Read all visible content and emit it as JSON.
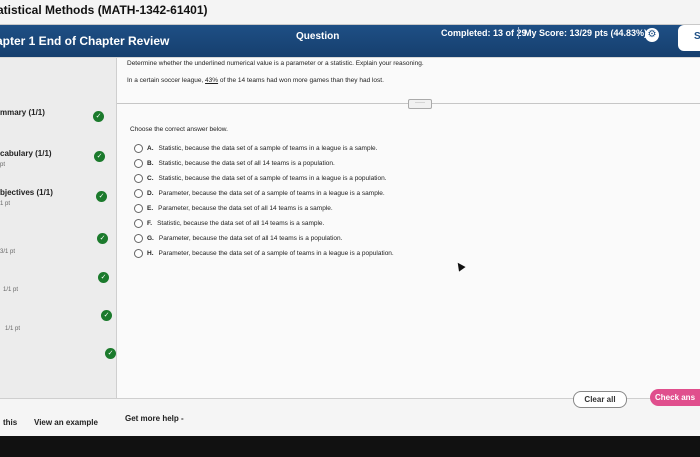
{
  "course_title": "atistical Methods (MATH-1342-61401)",
  "header": {
    "chapter": "apter 1 End of Chapter Review",
    "question_label": "Question",
    "completed": "Completed: 13 of 29",
    "score": "My Score: 13/29 pts (44.83%)",
    "save_label": "S"
  },
  "sidebar": {
    "items": [
      {
        "title": "mmary (1/1)",
        "sub": ""
      },
      {
        "title": "cabulary (1/1)",
        "sub": "pt"
      },
      {
        "title": "bjectives (1/1)",
        "sub": "1 pt"
      },
      {
        "title": "",
        "sub": "3/1 pt"
      },
      {
        "title": "",
        "sub": "1/1 pt"
      },
      {
        "title": "",
        "sub": "1/1 pt"
      }
    ]
  },
  "question": {
    "instruction": "Determine whether the underlined numerical value is a parameter or a statistic. Explain your reasoning.",
    "statement_before": "In a certain soccer league, ",
    "statement_value": "43%",
    "statement_after": " of the 14 teams had won more games than they had lost.",
    "more_label": "·····",
    "prompt": "Choose the correct answer below."
  },
  "options": [
    {
      "letter": "A.",
      "text": "Statistic, because the data set of a sample of teams in a league is a sample."
    },
    {
      "letter": "B.",
      "text": "Statistic, because the data set of all 14 teams is a population."
    },
    {
      "letter": "C.",
      "text": "Statistic, because the data set of a sample of teams in a league is a population."
    },
    {
      "letter": "D.",
      "text": "Parameter, because the data set of a sample of teams in a league is a sample."
    },
    {
      "letter": "E.",
      "text": "Parameter, because the data set of all 14 teams is a sample."
    },
    {
      "letter": "F.",
      "text": "Statistic, because the data set of all 14 teams is a sample."
    },
    {
      "letter": "G.",
      "text": "Parameter, because the data set of all 14 teams is a population."
    },
    {
      "letter": "H.",
      "text": "Parameter, because the data set of a sample of teams in a league is a population."
    }
  ],
  "footer": {
    "this_label": "this",
    "example_label": "View an example",
    "help_label": "Get more help -",
    "clear_label": "Clear all",
    "check_label": "Check ans"
  },
  "colors": {
    "header": "#1e4f85",
    "check": "#1b7a2c",
    "check_answer": "#e04f8d"
  }
}
